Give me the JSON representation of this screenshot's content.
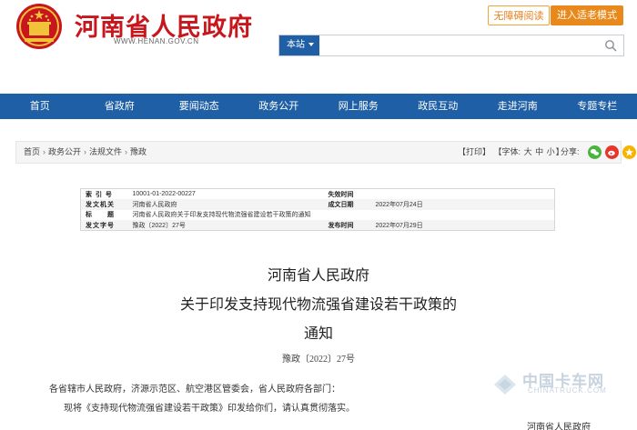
{
  "header": {
    "site_title": "河南省人民政府",
    "site_domain": "WWW.HENAN.GOV.CN",
    "accessibility_button": "无障碍阅读",
    "elder_mode_button": "进入适老模式",
    "search_scope": "本站",
    "search_placeholder": ""
  },
  "nav": {
    "items": [
      {
        "label": "首页"
      },
      {
        "label": "省政府"
      },
      {
        "label": "要闻动态"
      },
      {
        "label": "政务公开"
      },
      {
        "label": "网上服务"
      },
      {
        "label": "政民互动"
      },
      {
        "label": "走进河南"
      },
      {
        "label": "专题专栏"
      }
    ]
  },
  "breadcrumb": {
    "items": [
      "首页",
      "政务公开",
      "法规文件",
      "豫政"
    ],
    "separator": "›"
  },
  "tools": {
    "print": "【打印】",
    "font_label": "【字体:",
    "font_large": "大",
    "font_medium": "中",
    "font_small": "小",
    "font_end": "】",
    "share_label": "分享:"
  },
  "meta": {
    "index_label": "索 引 号",
    "index_value": "10001-01-2022-00227",
    "invalid_time_label": "失效时间",
    "invalid_time_value": "",
    "issuer_label": "发文机关",
    "issuer_value": "河南省人民政府",
    "written_date_label": "成文日期",
    "written_date_value": "2022年07月24日",
    "title_label": "标　　题",
    "title_value": "河南省人民政府关于印发支持现代物流强省建设若干政策的通知",
    "doc_no_label": "发文字号",
    "doc_no_value": "豫政〔2022〕27号",
    "publish_date_label": "发布时间",
    "publish_date_value": "2022年07月29日"
  },
  "document": {
    "title_line1": "河南省人民政府",
    "title_line2": "关于印发支持现代物流强省建设若干政策的",
    "title_line3": "通知",
    "doc_number": "豫政〔2022〕27号",
    "addressee": "各省辖市人民政府，济源示范区、航空港区管委会，省人民政府各部门：",
    "body_line": "现将《支持现代物流强省建设若干政策》印发给你们，请认真贯彻落实。",
    "signature": "河南省人民政府"
  },
  "watermark": {
    "cn": "中国卡车网",
    "en": "CHINATRUCK.COM"
  },
  "colors": {
    "brand_red": "#c8161d",
    "nav_blue": "#1f5fa5",
    "accent_orange": "#e9891b"
  }
}
